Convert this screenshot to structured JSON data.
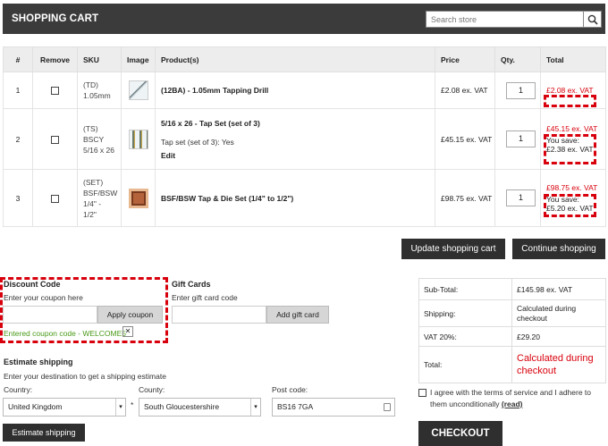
{
  "header": {
    "title": "SHOPPING CART",
    "search_placeholder": "Search store"
  },
  "table": {
    "headers": [
      "#",
      "Remove",
      "SKU",
      "Image",
      "Product(s)",
      "Price",
      "Qty.",
      "Total"
    ],
    "rows": [
      {
        "num": "1",
        "sku": [
          "(TD)",
          "1.05mm"
        ],
        "product": "(12BA) - 1.05mm Tapping Drill",
        "attributes": "",
        "edit": "",
        "price": "£2.08 ex. VAT",
        "qty": "1",
        "total": "£2.08 ex. VAT",
        "save_label": "",
        "save_amount": ""
      },
      {
        "num": "2",
        "sku": [
          "(TS)",
          "BSCY",
          "5/16 x 26"
        ],
        "product": "5/16 x 26 - Tap Set (set of 3)",
        "attributes": "Tap set (set of 3): Yes",
        "edit": "Edit",
        "price": "£45.15 ex. VAT",
        "qty": "1",
        "total": "£45.15 ex. VAT",
        "save_label": "You save:",
        "save_amount": "£2.38 ex. VAT"
      },
      {
        "num": "3",
        "sku": [
          "(SET)",
          "BSF/BSW",
          "1/4\" -",
          "1/2\""
        ],
        "product": "BSF/BSW Tap & Die Set (1/4\" to 1/2\")",
        "attributes": "",
        "edit": "",
        "price": "£98.75 ex. VAT",
        "qty": "1",
        "total": "£98.75 ex. VAT",
        "save_label": "You save:",
        "save_amount": "£5.20 ex. VAT"
      }
    ]
  },
  "buttons": {
    "update": "Update shopping cart",
    "continue": "Continue shopping",
    "apply_coupon": "Apply coupon",
    "add_gift_card": "Add gift card",
    "estimate": "Estimate shipping",
    "checkout": "CHECKOUT",
    "remove_coupon": "✕"
  },
  "discount": {
    "title": "Discount Code",
    "hint": "Enter your coupon here",
    "applied": "Entered coupon code - WELCOME5"
  },
  "gift": {
    "title": "Gift Cards",
    "hint": "Enter gift card code"
  },
  "shipping": {
    "title": "Estimate shipping",
    "hint": "Enter your destination to get a shipping estimate",
    "country_label": "Country:",
    "country_value": "United Kingdom",
    "county_label": "County:",
    "county_value": "South Gloucestershire",
    "postcode_label": "Post code:",
    "postcode_value": "BS16 7GA",
    "required_mark": "*"
  },
  "totals": {
    "subtotal_label": "Sub-Total:",
    "subtotal_value": "£145.98 ex. VAT",
    "shipping_label": "Shipping:",
    "shipping_value": "Calculated during checkout",
    "vat_label": "VAT 20%:",
    "vat_value": "£29.20",
    "total_label": "Total:",
    "total_value": "Calculated during checkout"
  },
  "terms": {
    "text": "I agree with the terms of service and I adhere to them unconditionally",
    "link": "(read)"
  },
  "colors": {
    "header_bg": "#3b3b3b",
    "accent_red": "#d8000c",
    "success_green": "#4a9a1a"
  }
}
